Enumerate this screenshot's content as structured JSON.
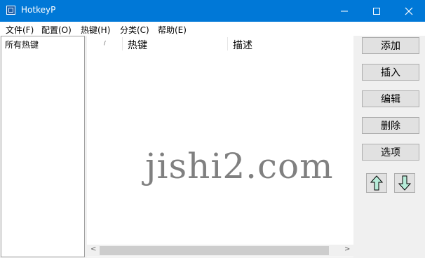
{
  "window": {
    "title": "HotkeyP"
  },
  "menu": {
    "items": [
      "文件(F)",
      "配置(O)",
      "热键(H)",
      "分类(C)",
      "帮助(E)"
    ]
  },
  "sidebar": {
    "items": [
      "所有热键"
    ]
  },
  "list": {
    "columns": [
      "/",
      "热键",
      "描述"
    ]
  },
  "buttons": {
    "add": "添加",
    "insert": "插入",
    "edit": "编辑",
    "delete": "删除",
    "options": "选项"
  },
  "scrollbar": {
    "left_arrow": "<",
    "right_arrow": ">"
  },
  "watermark": {
    "text": "jishi2.com"
  },
  "colors": {
    "titlebar": "#0078d7",
    "arrow_fill": "#b7ecd9"
  }
}
